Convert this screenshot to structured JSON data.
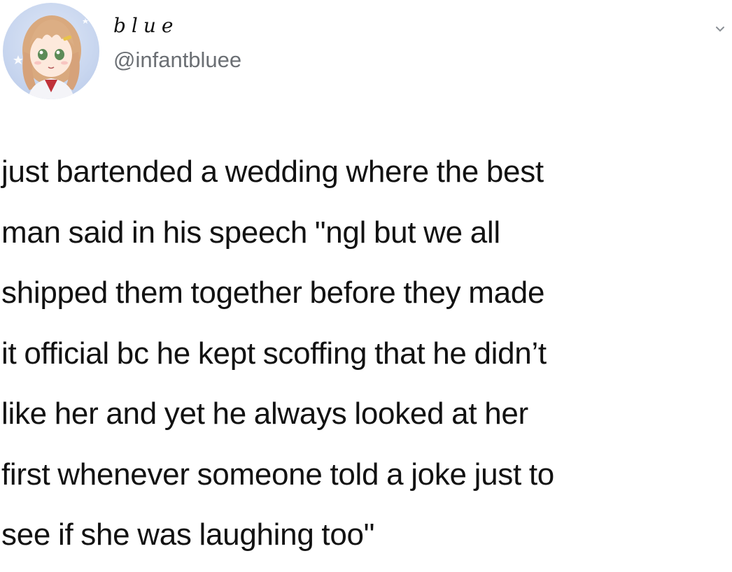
{
  "tweet": {
    "author": {
      "display_name": "blue",
      "handle": "@infantbluee",
      "avatar_icon": "anime-girl-avatar-icon"
    },
    "menu_icon": "chevron-down-icon",
    "text": "just bartended a wedding where the best\nman said in his speech \"ngl but we all\nshipped them together before they made\nit official bc he kept scoffing that he didn’t\nlike her and yet he always looked at her\nfirst whenever someone told a joke just to\nsee if she was laughing too\""
  },
  "colors": {
    "background": "#ffffff",
    "text": "#121212",
    "handle": "#6b6f74"
  }
}
